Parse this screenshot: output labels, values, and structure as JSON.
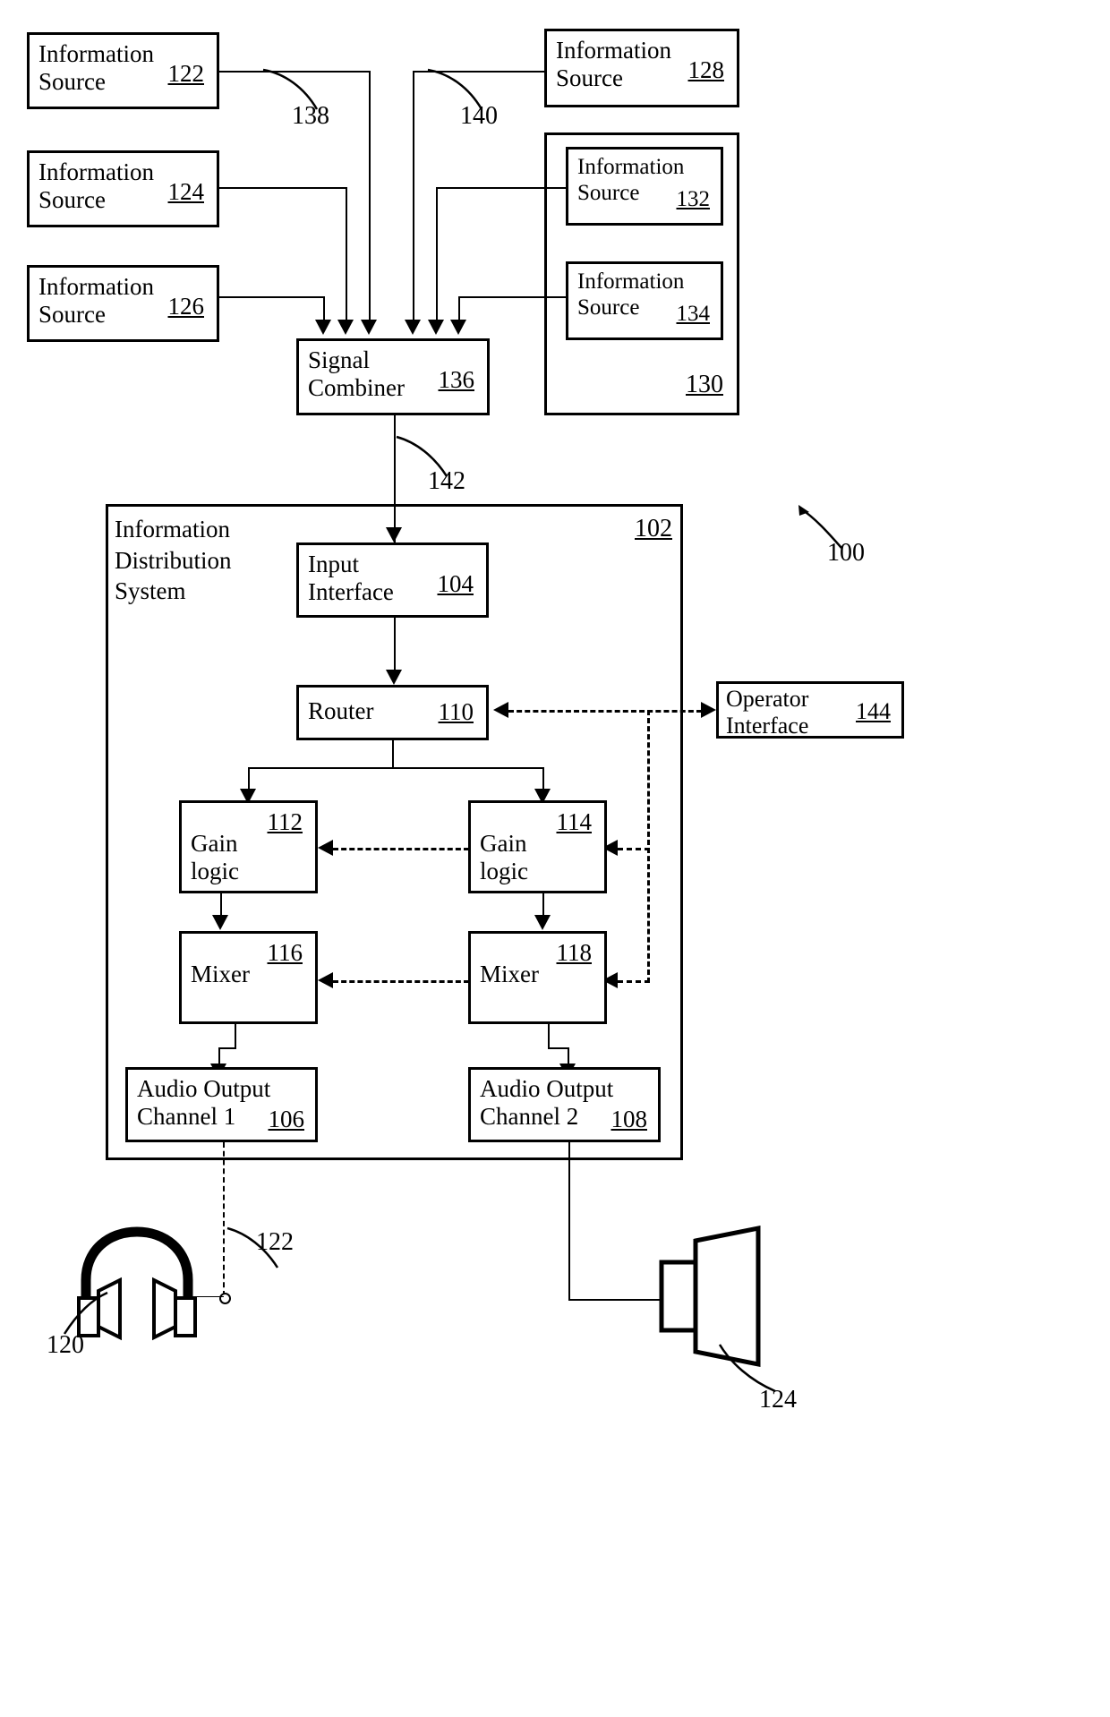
{
  "figure": {
    "ref_overall": "100",
    "nodes": {
      "info_source_122": {
        "label": "Information\nSource",
        "ref": "122"
      },
      "info_source_124": {
        "label": "Information\nSource",
        "ref": "124"
      },
      "info_source_126": {
        "label": "Information\nSource",
        "ref": "126"
      },
      "info_source_128": {
        "label": "Information\nSource",
        "ref": "128"
      },
      "info_source_132": {
        "label": "Information\nSource",
        "ref": "132"
      },
      "info_source_134": {
        "label": "Information\nSource",
        "ref": "134"
      },
      "source_group_130": {
        "ref": "130"
      },
      "signal_combiner": {
        "label": "Signal\nCombiner",
        "ref": "136"
      },
      "distribution_system": {
        "label": "Information\nDistribution\nSystem",
        "ref": "102"
      },
      "input_interface": {
        "label": "Input\nInterface",
        "ref": "104"
      },
      "router": {
        "label": "Router",
        "ref": "110"
      },
      "operator_interface": {
        "label": "Operator\nInterface",
        "ref": "144"
      },
      "gain_logic_1": {
        "label": "Gain\nlogic",
        "ref": "112"
      },
      "gain_logic_2": {
        "label": "Gain\nlogic",
        "ref": "114"
      },
      "mixer_1": {
        "label": "Mixer",
        "ref": "116"
      },
      "mixer_2": {
        "label": "Mixer",
        "ref": "118"
      },
      "audio_output_1": {
        "label": "Audio Output\nChannel 1",
        "ref": "106"
      },
      "audio_output_2": {
        "label": "Audio Output\nChannel 2",
        "ref": "108"
      }
    },
    "connector_labels": {
      "link_138": "138",
      "link_140": "140",
      "link_142": "142",
      "link_122_cable": "122"
    },
    "devices": {
      "headphones": {
        "ref": "120",
        "icon": "headphones-icon"
      },
      "speaker": {
        "ref": "124",
        "icon": "speaker-icon"
      }
    }
  }
}
